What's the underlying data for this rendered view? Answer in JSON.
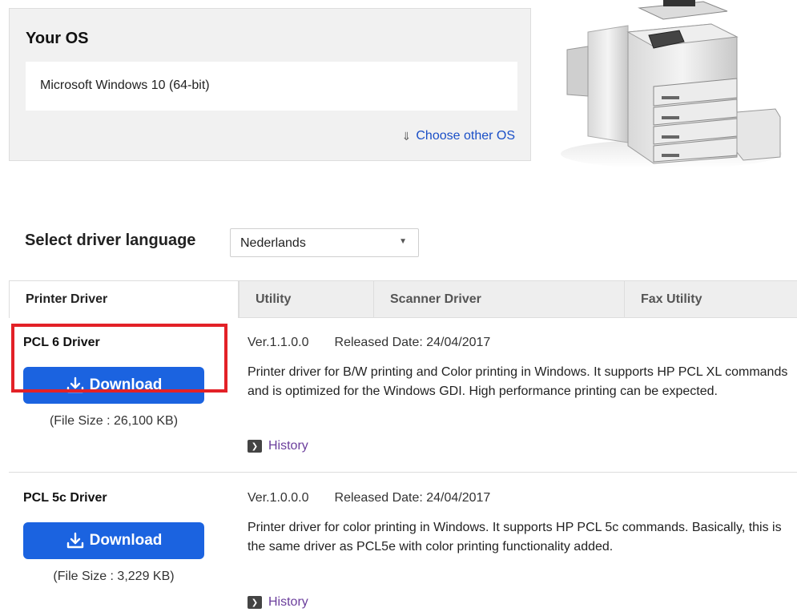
{
  "os_section": {
    "title": "Your OS",
    "value": "Microsoft Windows 10 (64-bit)",
    "choose_other_label": "Choose other OS"
  },
  "language": {
    "label": "Select driver language",
    "selected": "Nederlands"
  },
  "tabs": [
    {
      "label": "Printer Driver",
      "active": true
    },
    {
      "label": "Utility",
      "active": false
    },
    {
      "label": "Scanner Driver",
      "active": false
    },
    {
      "label": "Fax Utility",
      "active": false
    }
  ],
  "drivers": [
    {
      "name": "PCL 6 Driver",
      "download_label": "Download",
      "file_size": "(File Size : 26,100 KB)",
      "version": "Ver.1.1.0.0",
      "released": "Released Date: 24/04/2017",
      "description": "Printer driver for B/W printing and Color printing in Windows. It supports HP PCL XL commands and is optimized for the Windows GDI. High performance printing can be expected.",
      "history_label": "History"
    },
    {
      "name": "PCL 5c Driver",
      "download_label": "Download",
      "file_size": "(File Size : 3,229 KB)",
      "version": "Ver.1.0.0.0",
      "released": "Released Date: 24/04/2017",
      "description": "Printer driver for color printing in Windows. It supports HP PCL 5c commands. Basically, this is the same driver as PCL5e with color printing functionality added.",
      "history_label": "History"
    }
  ],
  "colors": {
    "accent": "#1b63e0",
    "link": "#1a4fc7",
    "history_link": "#6b3e9c",
    "highlight": "#e32127"
  },
  "icons": {
    "download": "download-icon",
    "history": "chevron-right-square-icon",
    "choose_os": "double-chevron-down-icon",
    "select": "caret-down-icon"
  }
}
